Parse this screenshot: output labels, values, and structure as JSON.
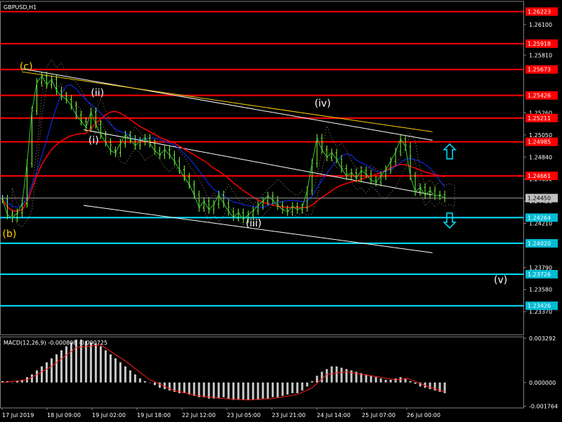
{
  "symbol_label": "GBPUSD,H1",
  "macd_label": "MACD(12,26,9) -0.000808 -0.000725",
  "chart_data": {
    "type": "line",
    "title": "GBPUSD,H1",
    "ylim": [
      1.2315,
      1.2632
    ],
    "price_ticks": [
      "1.26100",
      "1.25810",
      "1.25260",
      "1.25050",
      "1.24840",
      "1.24630",
      "1.24420",
      "1.24210",
      "1.23790",
      "1.23580",
      "1.23370"
    ],
    "time_labels": [
      "17 Jul 2019",
      "18 Jul 09:00",
      "19 Jul 02:00",
      "19 Jul 18:00",
      "22 Jul 12:00",
      "23 Jul 05:00",
      "23 Jul 21:00",
      "24 Jul 14:00",
      "25 Jul 07:00",
      "26 Jul 00:00"
    ],
    "resistance_levels": [
      "1.26223",
      "1.25918",
      "1.25673",
      "1.25426",
      "1.25211",
      "1.24985",
      "1.24661"
    ],
    "support_levels": [
      "1.24264",
      "1.24020",
      "1.23726",
      "1.23426"
    ],
    "current_price": "1.24450",
    "wave_labels": [
      {
        "text": "(c)",
        "x": 2,
        "y": 1.2567,
        "color": "#ffd000"
      },
      {
        "text": "(ii)",
        "x": 31,
        "y": 1.2542,
        "color": "#ffffff"
      },
      {
        "text": "(i)",
        "x": 30,
        "y": 1.2497,
        "color": "#ffffff"
      },
      {
        "text": "(iv)",
        "x": 122,
        "y": 1.2532,
        "color": "#ffffff"
      },
      {
        "text": "(iii)",
        "x": 94,
        "y": 1.2418,
        "color": "#ffffff"
      },
      {
        "text": "(b)",
        "x": -5,
        "y": 1.2408,
        "color": "#ffd000"
      },
      {
        "text": "(v)",
        "x": 195,
        "y": 1.2364,
        "color": "#ffffff"
      }
    ],
    "arrows": [
      {
        "direction": "up",
        "x": 177,
        "y": 1.2489
      },
      {
        "direction": "down",
        "x": 177,
        "y": 1.2424
      }
    ],
    "x_range": [
      -6,
      207
    ],
    "price": [
      [
        -5,
        1.2444
      ],
      [
        -3,
        1.2429
      ],
      [
        -1,
        1.2426
      ],
      [
        1,
        1.2431
      ],
      [
        3,
        1.244
      ],
      [
        5,
        1.2478
      ],
      [
        7,
        1.2528
      ],
      [
        9,
        1.2555
      ],
      [
        11,
        1.2561
      ],
      [
        13,
        1.2553
      ],
      [
        15,
        1.2558
      ],
      [
        17,
        1.2547
      ],
      [
        19,
        1.2542
      ],
      [
        21,
        1.2539
      ],
      [
        23,
        1.2533
      ],
      [
        25,
        1.2524
      ],
      [
        27,
        1.2518
      ],
      [
        29,
        1.2512
      ],
      [
        31,
        1.2527
      ],
      [
        33,
        1.2515
      ],
      [
        35,
        1.2505
      ],
      [
        37,
        1.2498
      ],
      [
        39,
        1.249
      ],
      [
        41,
        1.2488
      ],
      [
        43,
        1.2497
      ],
      [
        45,
        1.2505
      ],
      [
        47,
        1.2501
      ],
      [
        49,
        1.2495
      ],
      [
        51,
        1.2499
      ],
      [
        53,
        1.2502
      ],
      [
        55,
        1.2497
      ],
      [
        57,
        1.249
      ],
      [
        59,
        1.2486
      ],
      [
        61,
        1.2491
      ],
      [
        63,
        1.2486
      ],
      [
        65,
        1.248
      ],
      [
        67,
        1.2472
      ],
      [
        69,
        1.2465
      ],
      [
        71,
        1.2458
      ],
      [
        73,
        1.2448
      ],
      [
        75,
        1.2436
      ],
      [
        77,
        1.2442
      ],
      [
        79,
        1.2434
      ],
      [
        81,
        1.2439
      ],
      [
        83,
        1.2448
      ],
      [
        85,
        1.244
      ],
      [
        87,
        1.2432
      ],
      [
        89,
        1.2427
      ],
      [
        91,
        1.2431
      ],
      [
        93,
        1.2425
      ],
      [
        95,
        1.2429
      ],
      [
        97,
        1.2433
      ],
      [
        99,
        1.2438
      ],
      [
        101,
        1.2442
      ],
      [
        103,
        1.2447
      ],
      [
        105,
        1.2443
      ],
      [
        107,
        1.2438
      ],
      [
        109,
        1.2434
      ],
      [
        111,
        1.2432
      ],
      [
        113,
        1.2437
      ],
      [
        115,
        1.2434
      ],
      [
        117,
        1.2436
      ],
      [
        119,
        1.2452
      ],
      [
        121,
        1.2478
      ],
      [
        123,
        1.2502
      ],
      [
        125,
        1.2491
      ],
      [
        127,
        1.2484
      ],
      [
        129,
        1.2488
      ],
      [
        131,
        1.2482
      ],
      [
        133,
        1.2473
      ],
      [
        135,
        1.2466
      ],
      [
        137,
        1.2469
      ],
      [
        139,
        1.2464
      ],
      [
        141,
        1.2471
      ],
      [
        143,
        1.2468
      ],
      [
        145,
        1.2462
      ],
      [
        147,
        1.246
      ],
      [
        149,
        1.2466
      ],
      [
        151,
        1.2472
      ],
      [
        153,
        1.248
      ],
      [
        155,
        1.2489
      ],
      [
        157,
        1.2501
      ],
      [
        159,
        1.2494
      ],
      [
        161,
        1.2466
      ],
      [
        163,
        1.2451
      ],
      [
        165,
        1.2455
      ],
      [
        167,
        1.2448
      ],
      [
        169,
        1.2452
      ],
      [
        171,
        1.2447
      ],
      [
        173,
        1.2448
      ],
      [
        175,
        1.2445
      ]
    ],
    "macd_ticks": [
      "0.003292",
      "0.000000",
      "-0.001764"
    ],
    "macd_ylim": [
      -0.0019,
      0.0034
    ],
    "macd_histogram": [
      [
        -5,
        0.0001
      ],
      [
        -3,
        0.0001
      ],
      [
        -1,
        0.0
      ],
      [
        1,
        0.0001
      ],
      [
        3,
        0.0002
      ],
      [
        5,
        0.0004
      ],
      [
        7,
        0.0006
      ],
      [
        9,
        0.0009
      ],
      [
        11,
        0.0012
      ],
      [
        13,
        0.0015
      ],
      [
        15,
        0.0018
      ],
      [
        17,
        0.0021
      ],
      [
        19,
        0.0024
      ],
      [
        21,
        0.0027
      ],
      [
        23,
        0.003
      ],
      [
        25,
        0.0032
      ],
      [
        27,
        0.0032
      ],
      [
        29,
        0.0031
      ],
      [
        31,
        0.003
      ],
      [
        33,
        0.0029
      ],
      [
        35,
        0.0027
      ],
      [
        37,
        0.0024
      ],
      [
        39,
        0.0021
      ],
      [
        41,
        0.0018
      ],
      [
        43,
        0.0015
      ],
      [
        45,
        0.0012
      ],
      [
        47,
        0.0009
      ],
      [
        49,
        0.0006
      ],
      [
        51,
        0.0003
      ],
      [
        53,
        0.0001
      ],
      [
        55,
        0.0
      ],
      [
        57,
        -0.0002
      ],
      [
        59,
        -0.0004
      ],
      [
        61,
        -0.0005
      ],
      [
        63,
        -0.0006
      ],
      [
        65,
        -0.0007
      ],
      [
        67,
        -0.0008
      ],
      [
        69,
        -0.0008
      ],
      [
        71,
        -0.0009
      ],
      [
        73,
        -0.001
      ],
      [
        75,
        -0.0011
      ],
      [
        77,
        -0.0011
      ],
      [
        79,
        -0.0012
      ],
      [
        81,
        -0.0012
      ],
      [
        83,
        -0.0012
      ],
      [
        85,
        -0.0011
      ],
      [
        87,
        -0.0012
      ],
      [
        89,
        -0.0013
      ],
      [
        91,
        -0.0013
      ],
      [
        93,
        -0.0013
      ],
      [
        95,
        -0.0013
      ],
      [
        97,
        -0.0013
      ],
      [
        99,
        -0.0013
      ],
      [
        101,
        -0.0012
      ],
      [
        103,
        -0.0012
      ],
      [
        105,
        -0.0011
      ],
      [
        107,
        -0.0011
      ],
      [
        109,
        -0.001
      ],
      [
        111,
        -0.0009
      ],
      [
        113,
        -0.0008
      ],
      [
        115,
        -0.0008
      ],
      [
        117,
        -0.0006
      ],
      [
        119,
        -0.0003
      ],
      [
        121,
        0.0001
      ],
      [
        123,
        0.0005
      ],
      [
        125,
        0.0008
      ],
      [
        127,
        0.001
      ],
      [
        129,
        0.0012
      ],
      [
        131,
        0.0012
      ],
      [
        133,
        0.0011
      ],
      [
        135,
        0.001
      ],
      [
        137,
        0.0009
      ],
      [
        139,
        0.0008
      ],
      [
        141,
        0.0007
      ],
      [
        143,
        0.0006
      ],
      [
        145,
        0.0005
      ],
      [
        147,
        0.0004
      ],
      [
        149,
        0.0003
      ],
      [
        151,
        0.0002
      ],
      [
        153,
        0.0002
      ],
      [
        155,
        0.0003
      ],
      [
        157,
        0.0004
      ],
      [
        159,
        0.0003
      ],
      [
        161,
        0.0001
      ],
      [
        163,
        -0.0001
      ],
      [
        165,
        -0.0003
      ],
      [
        167,
        -0.0004
      ],
      [
        169,
        -0.0005
      ],
      [
        171,
        -0.0006
      ],
      [
        173,
        -0.0007
      ],
      [
        175,
        -0.0008
      ]
    ],
    "macd_signal": [
      [
        -5,
        0.0
      ],
      [
        5,
        0.0002
      ],
      [
        15,
        0.0012
      ],
      [
        25,
        0.0026
      ],
      [
        35,
        0.0028
      ],
      [
        45,
        0.0016
      ],
      [
        55,
        0.0002
      ],
      [
        65,
        -0.0006
      ],
      [
        75,
        -0.001
      ],
      [
        85,
        -0.0012
      ],
      [
        95,
        -0.0013
      ],
      [
        105,
        -0.0012
      ],
      [
        115,
        -0.0009
      ],
      [
        121,
        -0.0004
      ],
      [
        127,
        0.0006
      ],
      [
        135,
        0.0008
      ],
      [
        145,
        0.0005
      ],
      [
        155,
        0.0002
      ],
      [
        160,
        0.0003
      ],
      [
        168,
        -0.0003
      ],
      [
        175,
        -0.0007
      ]
    ]
  }
}
